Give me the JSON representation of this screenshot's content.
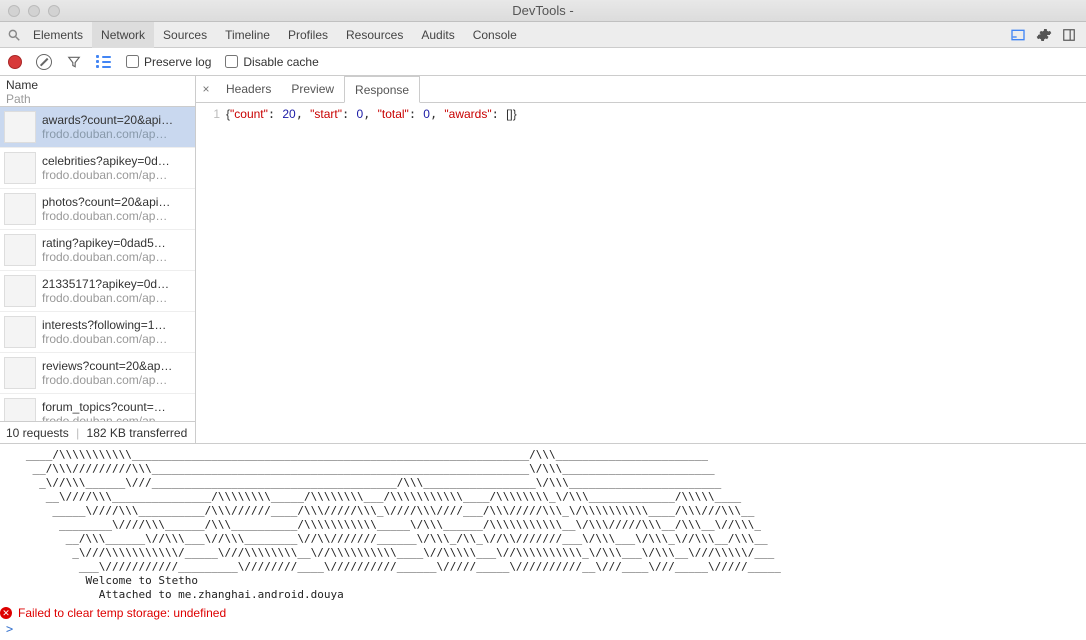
{
  "window": {
    "title": "DevTools -"
  },
  "tabs": {
    "items": [
      "Elements",
      "Network",
      "Sources",
      "Timeline",
      "Profiles",
      "Resources",
      "Audits",
      "Console"
    ],
    "active_index": 1
  },
  "toolbar": {
    "preserve_log_label": "Preserve log",
    "disable_cache_label": "Disable cache"
  },
  "requests_panel": {
    "header_name": "Name",
    "header_path": "Path",
    "footer_requests": "10 requests",
    "footer_transferred": "182 KB transferred",
    "list": [
      {
        "name": "awards?count=20&api…",
        "path": "frodo.douban.com/ap…"
      },
      {
        "name": "celebrities?apikey=0d…",
        "path": "frodo.douban.com/ap…"
      },
      {
        "name": "photos?count=20&api…",
        "path": "frodo.douban.com/ap…"
      },
      {
        "name": "rating?apikey=0dad5…",
        "path": "frodo.douban.com/ap…"
      },
      {
        "name": "21335171?apikey=0d…",
        "path": "frodo.douban.com/ap…"
      },
      {
        "name": "interests?following=1…",
        "path": "frodo.douban.com/ap…"
      },
      {
        "name": "reviews?count=20&ap…",
        "path": "frodo.douban.com/ap…"
      },
      {
        "name": "forum_topics?count=…",
        "path": "frodo.douban.com/ap…"
      }
    ],
    "selected_index": 0
  },
  "response_tabs": {
    "items": [
      "Headers",
      "Preview",
      "Response"
    ],
    "active_index": 2
  },
  "response_body": {
    "line_no": "1",
    "json": {
      "count": 20,
      "start": 0,
      "total": 0,
      "awards_literal": "[]"
    },
    "keys": {
      "count": "\"count\"",
      "start": "\"start\"",
      "total": "\"total\"",
      "awards": "\"awards\""
    }
  },
  "console": {
    "ascii": "   ____/\\\\\\\\\\\\\\\\\\\\\\____________________________________________________________/\\\\\\_______________________\n    __/\\\\\\/////////\\\\\\_________________________________________________________\\/\\\\\\_______________________\n     _\\//\\\\\\______\\///_____________________________________/\\\\\\_________________\\/\\\\\\_______________________\n      __\\////\\\\\\_______________/\\\\\\\\\\\\\\\\_____/\\\\\\\\\\\\\\\\___/\\\\\\\\\\\\\\\\\\\\\\____/\\\\\\\\\\\\\\\\_\\/\\\\\\_____________/\\\\\\\\\\____\n       _____\\////\\\\\\__________/\\\\\\//////____/\\\\\\/////\\\\\\_\\////\\\\\\////___/\\\\\\/////\\\\\\_\\/\\\\\\\\\\\\\\\\\\\\____/\\\\\\///\\\\\\__\n        ________\\////\\\\\\______/\\\\\\__________/\\\\\\\\\\\\\\\\\\\\\\_____\\/\\\\\\______/\\\\\\\\\\\\\\\\\\\\\\__\\/\\\\\\/////\\\\\\__/\\\\\\__\\//\\\\\\_\n         __/\\\\\\______\\//\\\\\\___\\//\\\\\\________\\//\\\\///////______\\/\\\\\\_/\\\\_\\//\\\\///////___\\/\\\\\\___\\/\\\\\\_\\//\\\\\\__/\\\\\\__\n          _\\///\\\\\\\\\\\\\\\\\\\\\\/_____\\///\\\\\\\\\\\\\\\\__\\//\\\\\\\\\\\\\\\\\\\\____\\//\\\\\\\\\\___\\//\\\\\\\\\\\\\\\\\\\\_\\/\\\\\\___\\/\\\\\\__\\///\\\\\\\\\\/___\n           ___\\///////////_________\\////////____\\//////////______\\/////_____\\//////////__\\///____\\///_____\\/////_____\n            Welcome to Stetho\n              Attached to me.zhanghai.android.douya",
    "error": "Failed to clear temp storage: undefined",
    "prompt": ">"
  }
}
